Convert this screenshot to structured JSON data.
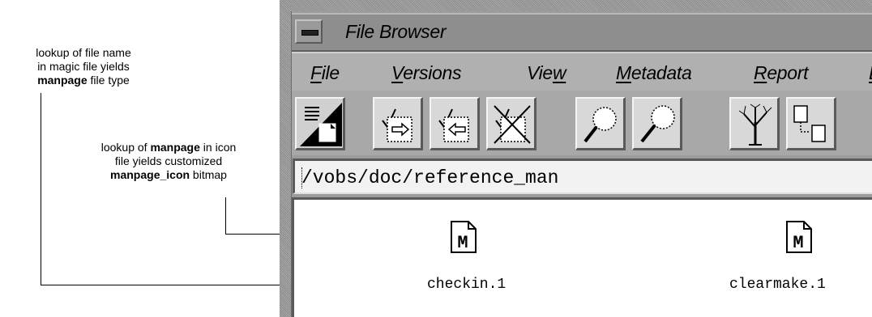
{
  "annotations": {
    "file_type": {
      "line1": "lookup of file name",
      "line2": "in magic file yields",
      "line3_bold": "manpage",
      "line3_rest": " file type"
    },
    "icon_bitmap": {
      "line1_pre": "lookup of ",
      "line1_bold": "manpage",
      "line1_post": " in icon",
      "line2": "file yields customized",
      "line3_bold": "manpage_icon",
      "line3_rest": " bitmap"
    }
  },
  "window": {
    "title": "File Browser",
    "window_menu_icon": "window-menu-icon"
  },
  "menubar": {
    "items": [
      {
        "first": "F",
        "rest": "ile"
      },
      {
        "first": "V",
        "rest": "ersions"
      },
      {
        "pre": "Vie",
        "under": "w"
      },
      {
        "first": "M",
        "rest": "etadata"
      },
      {
        "first": "R",
        "rest": "eport"
      },
      {
        "first": "E",
        "rest": ""
      }
    ]
  },
  "toolbar": {
    "buttons": [
      {
        "icon": "view-toggle-icon"
      },
      {
        "icon": "checkout-icon"
      },
      {
        "icon": "checkin-icon"
      },
      {
        "icon": "uncheckout-icon"
      },
      {
        "icon": "find-icon"
      },
      {
        "icon": "find-next-icon"
      },
      {
        "icon": "version-tree-icon"
      },
      {
        "icon": "history-icon"
      }
    ]
  },
  "path": {
    "value": "/vobs/doc/reference_man"
  },
  "files": [
    {
      "name": "checkin.1",
      "icon": "manpage-icon",
      "glyph": "M"
    },
    {
      "name": "clearmake.1",
      "icon": "manpage-icon",
      "glyph": "M"
    }
  ]
}
